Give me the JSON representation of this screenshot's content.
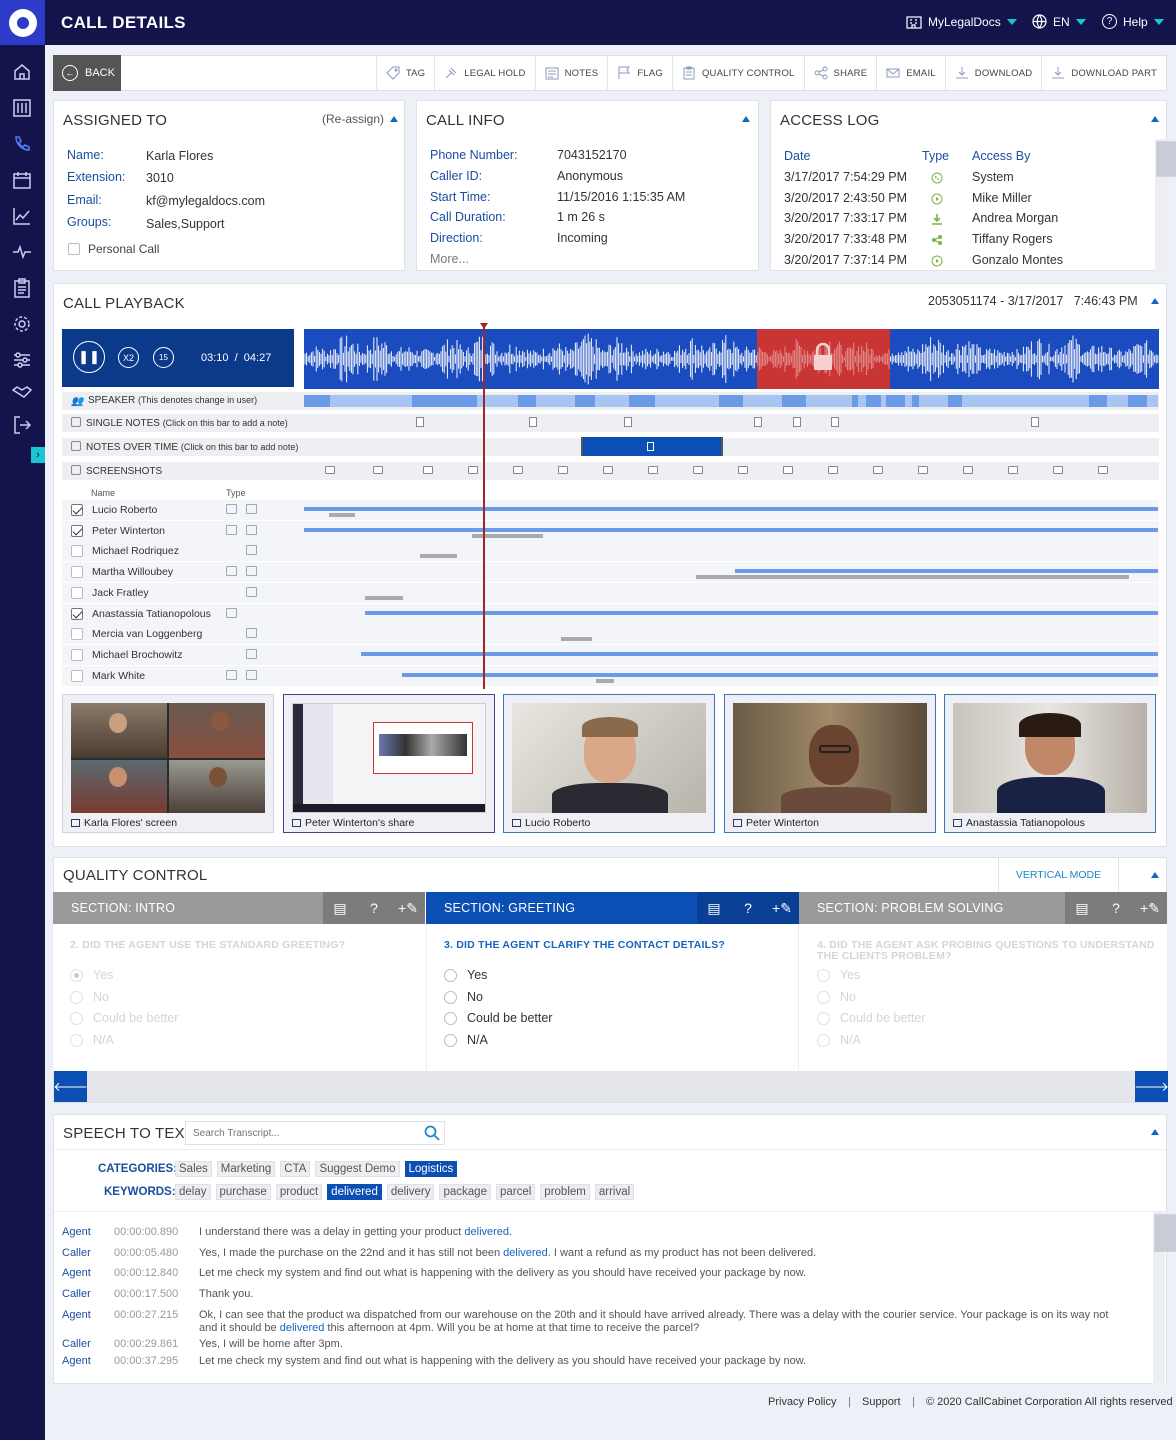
{
  "app": {
    "title": "CALL DETAILS",
    "workspace": "MyLegalDocs",
    "language": "EN",
    "help": "Help"
  },
  "toolbar": {
    "back": "BACK",
    "tools": [
      "TAG",
      "LEGAL HOLD",
      "NOTES",
      "FLAG",
      "QUALITY CONTROL",
      "SHARE",
      "EMAIL",
      "DOWNLOAD",
      "DOWNLOAD PART"
    ]
  },
  "assigned": {
    "title": "ASSIGNED TO",
    "reassign": "(Re-assign)",
    "fields": [
      {
        "k": "Name:",
        "v": "Karla Flores"
      },
      {
        "k": "Extension:",
        "v": "3010"
      },
      {
        "k": "Email:",
        "v": "kf@mylegaldocs.com"
      },
      {
        "k": "Groups:",
        "v": "Sales,Support"
      }
    ],
    "personal": "Personal Call"
  },
  "callinfo": {
    "title": "CALL INFO",
    "fields": [
      {
        "k": "Phone Number:",
        "v": "7043152170"
      },
      {
        "k": "Caller ID:",
        "v": "Anonymous"
      },
      {
        "k": "Start Time:",
        "v": "11/15/2016 1:15:35 AM"
      },
      {
        "k": "Call Duration:",
        "v": "1 m 26 s"
      },
      {
        "k": "Direction:",
        "v": "Incoming"
      }
    ],
    "more": "More..."
  },
  "access": {
    "title": "ACCESS LOG",
    "headers": [
      "Date",
      "Type",
      "Access By"
    ],
    "rows": [
      {
        "date": "3/17/2017 7:54:29 PM",
        "type": "phone",
        "by": "System"
      },
      {
        "date": "3/20/2017 2:43:50 PM",
        "type": "play",
        "by": "Mike Miller"
      },
      {
        "date": "3/20/2017 7:33:17 PM",
        "type": "download",
        "by": "Andrea Morgan"
      },
      {
        "date": "3/20/2017 7:33:48 PM",
        "type": "share",
        "by": "Tiffany Rogers"
      },
      {
        "date": "3/20/2017 7:37:14 PM",
        "type": "play",
        "by": "Gonzalo Montes"
      }
    ],
    "colors": {
      "green": "#7cb342"
    }
  },
  "playback": {
    "title": "CALL PLAYBACK",
    "meta": "2053051174 - 3/17/2017   7:46:43 PM",
    "speed": "X2",
    "skip": "15",
    "time": "03:10  /  04:27",
    "tracks": {
      "speaker": "SPEAKER",
      "speaker_hint": "(This denotes change in user)",
      "single": "SINGLE NOTES",
      "single_hint": "(Click on this bar to add a note)",
      "overtime": "NOTES OVER TIME",
      "overtime_hint": "(Click on this bar to add note)",
      "screens": "SCREENSHOTS"
    },
    "cols": {
      "name": "Name",
      "type": "Type"
    },
    "participants": [
      {
        "name": "Lucio Roberto",
        "checked": true
      },
      {
        "name": "Peter Winterton",
        "checked": true
      },
      {
        "name": "Michael Rodriquez",
        "checked": false
      },
      {
        "name": "Martha Willoubey",
        "checked": false
      },
      {
        "name": "Jack Fratley",
        "checked": false
      },
      {
        "name": "Anastassia Tatianopolous",
        "checked": true
      },
      {
        "name": "Mercia van Loggenberg",
        "checked": false
      },
      {
        "name": "Michael Brochowitz",
        "checked": false
      },
      {
        "name": "Mark White",
        "checked": false
      }
    ],
    "thumbs": [
      "Karla Flores' screen",
      "Peter Winterton's share",
      "Lucio Roberto",
      "Peter Winterton",
      "Anastassia Tatianopolous"
    ]
  },
  "qc": {
    "title": "QUALITY CONTROL",
    "mode": "VERTICAL MODE",
    "sections": [
      {
        "name": "SECTION: INTRO",
        "question": "2. DID THE AGENT USE THE STANDARD GREETING?"
      },
      {
        "name": "SECTION: GREETING",
        "question": "3. DID THE AGENT CLARIFY THE CONTACT DETAILS?"
      },
      {
        "name": "SECTION: PROBLEM SOLVING",
        "question": "4. DID THE AGENT ASK PROBING QUESTIONS TO UNDERSTAND THE CLIENTS PROBLEM?"
      }
    ],
    "options": [
      "Yes",
      "No",
      "Could be better",
      "N/A"
    ]
  },
  "stt": {
    "title": "SPEECH TO TEXT",
    "placeholder": "Search Transcript...",
    "cat_label": "CATEGORIES:",
    "kw_label": "KEYWORDS:",
    "categories": [
      {
        "t": "Sales"
      },
      {
        "t": "Marketing"
      },
      {
        "t": "CTA"
      },
      {
        "t": "Suggest Demo"
      },
      {
        "t": "Logistics",
        "on": true
      }
    ],
    "keywords": [
      {
        "t": "delay"
      },
      {
        "t": "purchase"
      },
      {
        "t": "product"
      },
      {
        "t": "delivered",
        "on": true
      },
      {
        "t": "delivery"
      },
      {
        "t": "package"
      },
      {
        "t": "parcel"
      },
      {
        "t": "problem"
      },
      {
        "t": "arrival"
      }
    ],
    "lines": [
      {
        "sp": "Agent",
        "tm": "00:00:00.890",
        "a": "I understand there was a delay in getting your product ",
        "h": "delivered",
        "b": "."
      },
      {
        "sp": "Caller",
        "tm": "00:00:05.480",
        "a": "Yes, I made the purchase on the 22nd and it has still not been ",
        "h": "delivered",
        "b": ". I want a refund as my product has not been delivered."
      },
      {
        "sp": "Agent",
        "tm": "00:00:12.840",
        "a": "Let me check my system and find out what is happening with the delivery as you should have received your package by now.",
        "h": "",
        "b": ""
      },
      {
        "sp": "Caller",
        "tm": "00:00:17.500",
        "a": "Thank you.",
        "h": "",
        "b": ""
      },
      {
        "sp": "Agent",
        "tm": "00:00:27.215",
        "a": "Ok, I can see that the product wa dispatched from our warehouse on the 20th and it should have arrived already. There was a delay with the courier service. Your package is on its way not and it should be ",
        "h": "delivered",
        "b": " this afternoon at 4pm. Will you be at home at that time to receive the parcel?"
      },
      {
        "sp": "Caller",
        "tm": "00:00:29.861",
        "a": "Yes, I will be home after 3pm.",
        "h": "",
        "b": ""
      },
      {
        "sp": "Agent",
        "tm": "00:00:37.295",
        "a": "Let me check my system and find out what is happening with the delivery as you should have received your package by now.",
        "h": "",
        "b": ""
      }
    ]
  },
  "footer": {
    "privacy": "Privacy Policy",
    "support": "Support",
    "copy": "© 2020 CallCabinet Corporation All rights reserved"
  }
}
